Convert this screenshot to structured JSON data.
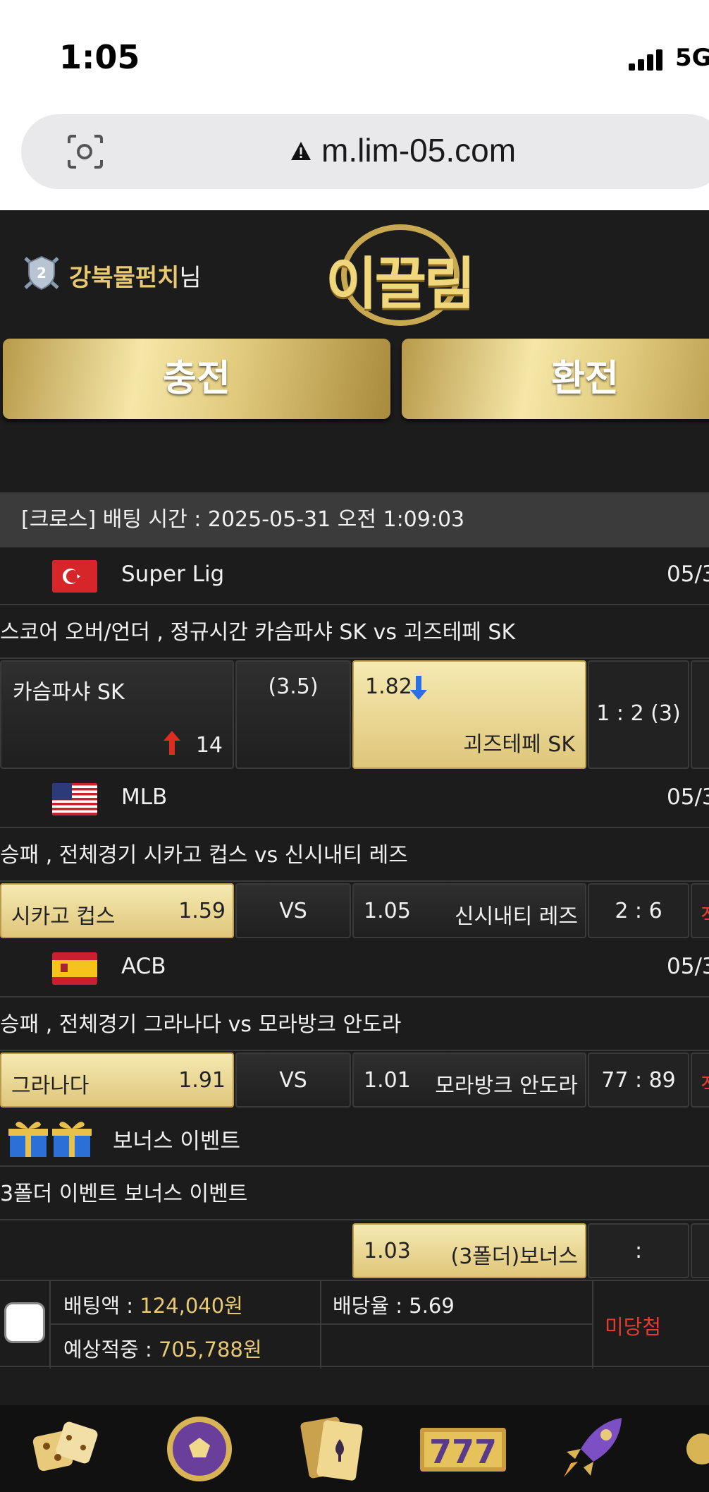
{
  "status": {
    "time": "1:05",
    "network": "5G"
  },
  "browser": {
    "url": "m.lim-05.com"
  },
  "header": {
    "username": "강북물펀치",
    "username_suffix": "님",
    "logo_text": "이끌림"
  },
  "actions": {
    "charge": "충전",
    "exchange": "환전"
  },
  "bet": {
    "header": "[크로스] 배팅 시간 : 2025-05-31 오전 1:09:03",
    "matches": [
      {
        "league": "Super Lig",
        "date": "05/3",
        "title": "스코어 오버/언더 , 정규시간 카슴파샤 SK  vs  괴즈테페 SK",
        "home": "카슴파샤 SK",
        "home_odds": "14",
        "handicap": "(3.5)",
        "away_odds": "1.82",
        "away": "괴즈테페 SK",
        "score": "1 : 2 (3)"
      },
      {
        "league": "MLB",
        "date": "05/3",
        "title": "승패 , 전체경기 시카고 컵스  vs  신시내티 레즈",
        "home": "시카고 컵스",
        "home_odds": "1.59",
        "handicap": "VS",
        "away_odds": "1.05",
        "away": "신시내티 레즈",
        "score": "2 : 6",
        "result_partial": "적"
      },
      {
        "league": "ACB",
        "date": "05/3",
        "title": "승패 , 전체경기 그라나다  vs  모라방크 안도라",
        "home": "그라나다",
        "home_odds": "1.91",
        "handicap": "VS",
        "away_odds": "1.01",
        "away": "모라방크 안도라",
        "score": "77 : 89",
        "result_partial": "적"
      }
    ],
    "bonus": {
      "league": "보너스 이벤트",
      "title": "3폴더 이벤트 보너스 이벤트",
      "odds": "1.03",
      "label": "(3폴더)보너스",
      "score": ":"
    },
    "summary": {
      "amount_label": "배팅액 : ",
      "amount": "124,040원",
      "rate_label": "배당율 : 5.69",
      "expected_label": "예상적중 : ",
      "expected": "705,788원",
      "result": "미당첨"
    }
  },
  "tabbar": {
    "icons": [
      "dice-icon",
      "soccer-ball-icon",
      "cards-icon",
      "slot-777-icon",
      "rocket-icon"
    ],
    "slot_text": "777"
  }
}
